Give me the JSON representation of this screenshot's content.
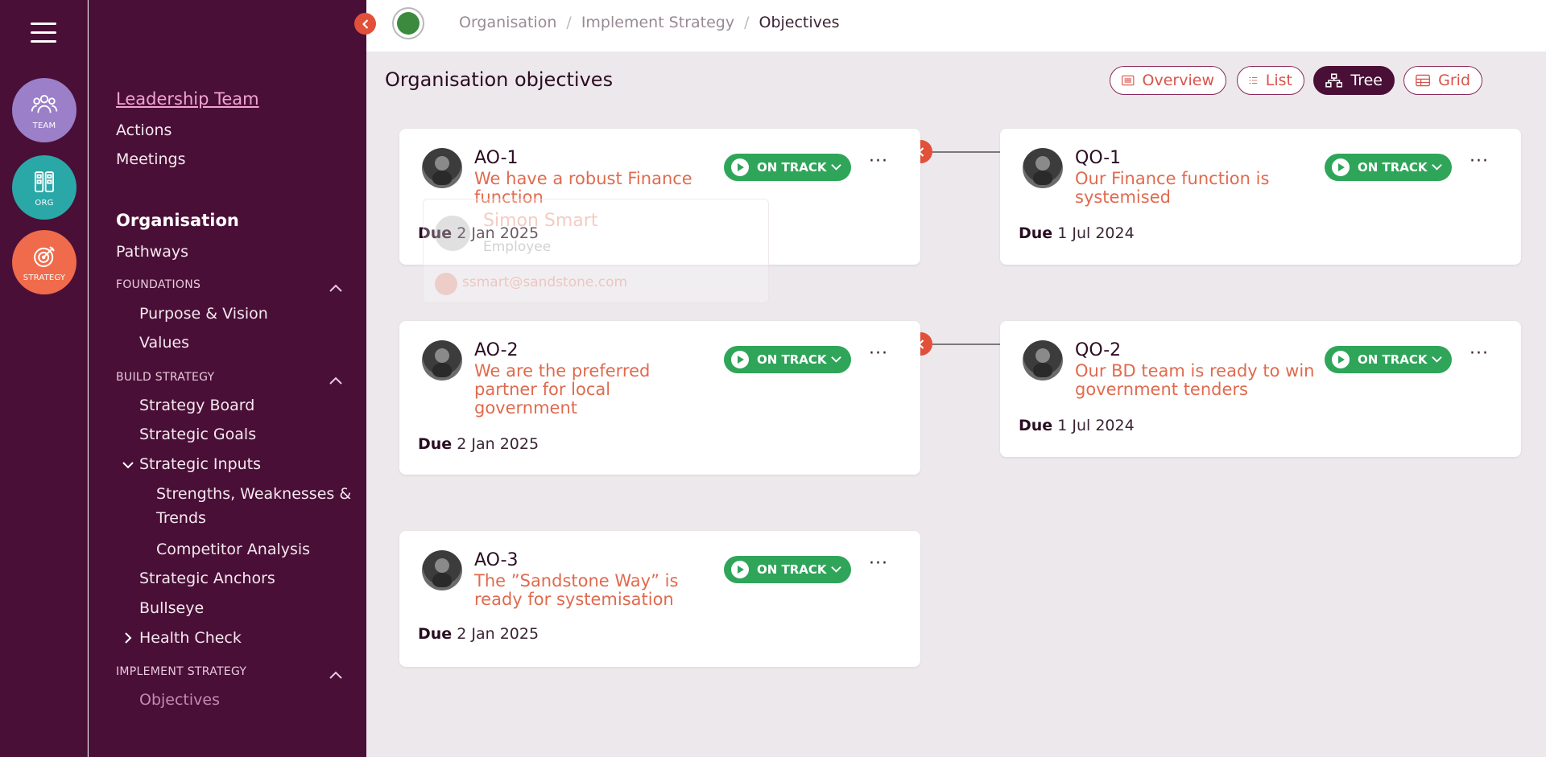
{
  "rail": {
    "team_label": "TEAM",
    "org_label": "ORG",
    "strategy_label": "STRATEGY"
  },
  "sidebar": {
    "leadership_team": "Leadership Team",
    "actions": "Actions",
    "meetings": "Meetings",
    "organisation": "Organisation",
    "pathways": "Pathways",
    "foundations": "FOUNDATIONS",
    "purpose_vision": "Purpose & Vision",
    "values": "Values",
    "build_strategy": "BUILD STRATEGY",
    "strategy_board": "Strategy Board",
    "strategic_goals": "Strategic Goals",
    "strategic_inputs": "Strategic Inputs",
    "swt_line1": "Strengths, Weaknesses &",
    "swt_line2": "Trends",
    "competitor_analysis": "Competitor Analysis",
    "strategic_anchors": "Strategic Anchors",
    "bullseye": "Bullseye",
    "health_check": "Health Check",
    "implement_strategy": "IMPLEMENT STRATEGY",
    "objectives": "Objectives"
  },
  "breadcrumb": {
    "items": [
      "Organisation",
      "Implement Strategy",
      "Objectives"
    ],
    "separator": "/"
  },
  "page": {
    "title": "Organisation objectives"
  },
  "views": {
    "overview": "Overview",
    "list": "List",
    "tree": "Tree",
    "grid": "Grid",
    "active": "Tree"
  },
  "due_label": "Due",
  "objectives": {
    "ao1": {
      "code": "AO-1",
      "title": "We have a robust Finance function",
      "status": "ON TRACK",
      "due": "2 Jan 2025"
    },
    "ao2": {
      "code": "AO-2",
      "title": "We are the preferred partner for local government",
      "status": "ON TRACK",
      "due": "2 Jan 2025"
    },
    "ao3": {
      "code": "AO-3",
      "title": "The ”Sandstone Way” is ready for systemisation",
      "status": "ON TRACK",
      "due": "2 Jan 2025"
    },
    "qo1": {
      "code": "QO-1",
      "title": "Our Finance function is systemised",
      "status": "ON TRACK",
      "due": "1 Jul 2024"
    },
    "qo2": {
      "code": "QO-2",
      "title": "Our BD team is ready to win government tenders",
      "status": "ON TRACK",
      "due": "1 Jul 2024"
    }
  },
  "popover": {
    "name": "Simon Smart",
    "role": "Employee",
    "email": "ssmart@sandstone.com"
  },
  "colors": {
    "rail_bg": "#4a0f36",
    "accent": "#e2503a",
    "status_green": "#2fa55a",
    "title_coral": "#e06a4e"
  }
}
